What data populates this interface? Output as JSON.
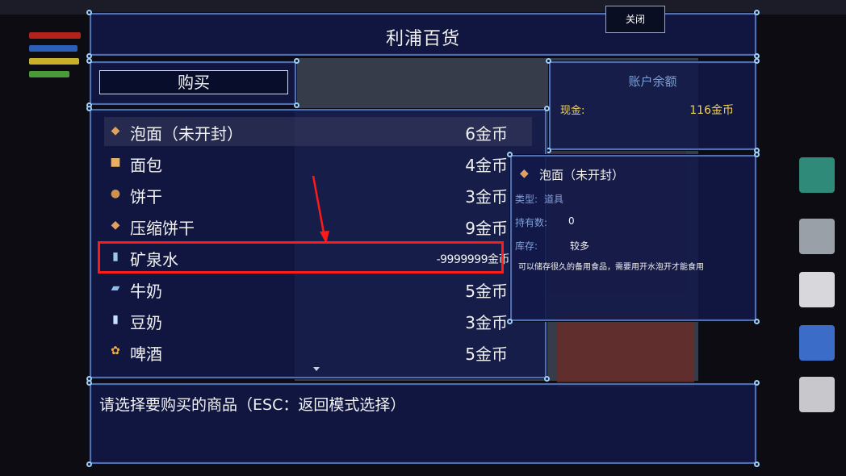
{
  "shop": {
    "title": "利浦百货",
    "close_label": "关闭",
    "buy_label": "购买"
  },
  "balance": {
    "title": "账户余额",
    "cash_label": "现金:",
    "cash_value": "116金币"
  },
  "items": [
    {
      "icon": "noodle-box-icon",
      "name": "泡面（未开封）",
      "price": "6金币"
    },
    {
      "icon": "bread-icon",
      "name": "面包",
      "price": "4金币"
    },
    {
      "icon": "cookie-icon",
      "name": "饼干",
      "price": "3金币"
    },
    {
      "icon": "compressed-biscuit-icon",
      "name": "压缩饼干",
      "price": "9金币"
    },
    {
      "icon": "water-bottle-icon",
      "name": "矿泉水",
      "price": "-9999999金币"
    },
    {
      "icon": "milk-carton-icon",
      "name": "牛奶",
      "price": "5金币"
    },
    {
      "icon": "soy-milk-bottle-icon",
      "name": "豆奶",
      "price": "3金币"
    },
    {
      "icon": "beer-icon",
      "name": "啤酒",
      "price": "5金币"
    }
  ],
  "detail": {
    "icon": "noodle-box-icon",
    "name": "泡面（未开封）",
    "type_label": "类型:",
    "type_value": "道具",
    "owned_label": "持有数:",
    "owned_value": "0",
    "stock_label": "库存:",
    "stock_value": "较多",
    "description": "可以储存很久的备用食品，需要用开水泡开才能食用"
  },
  "help": {
    "text": "请选择要购买的商品（ESC：返回模式选择）"
  },
  "colors": {
    "panel_bg": "#121848",
    "panel_border": "#4d6fb0",
    "accent_gold": "#f2d35a",
    "label_blue": "#7fa0d8",
    "annotation_red": "#ff1a1a"
  }
}
